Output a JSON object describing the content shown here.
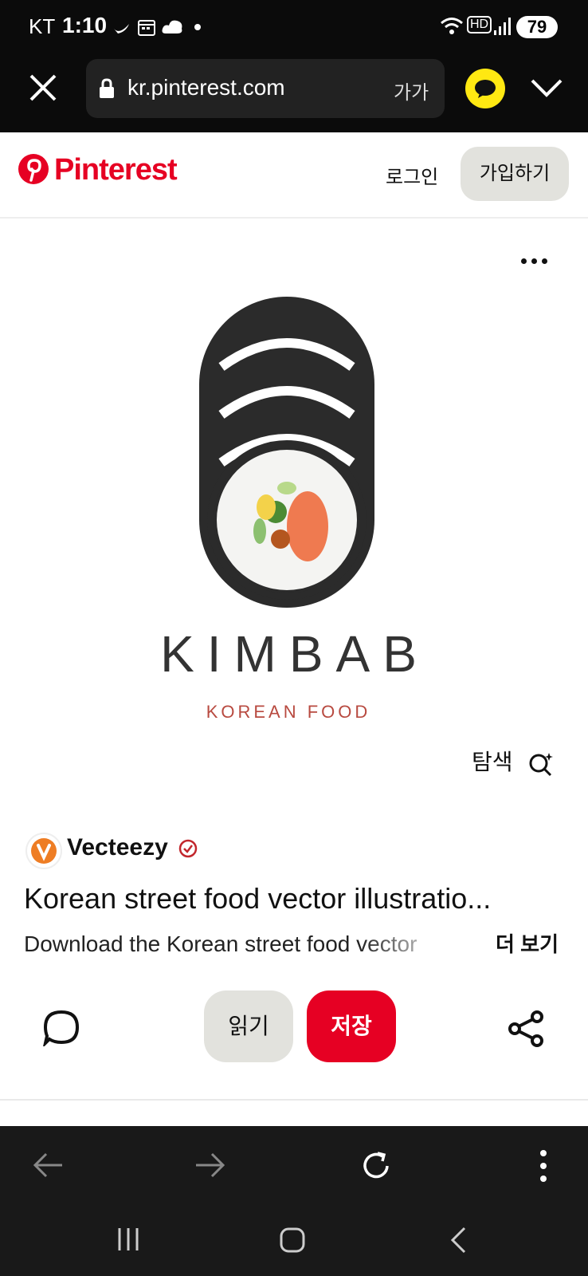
{
  "status_bar": {
    "carrier": "KT",
    "time": "1:10",
    "battery": "79",
    "network_label": "HD"
  },
  "browser": {
    "url": "kr.pinterest.com",
    "text_size_label": "가가"
  },
  "header": {
    "logo": "Pinterest",
    "login_label": "로그인",
    "signup_label": "가입하기"
  },
  "pin": {
    "image_brand_title": "KIMBAB",
    "image_brand_subtitle": "KOREAN FOOD",
    "explore_label": "탐색",
    "source_name": "Vecteezy",
    "title": "Korean street food vector illustratio...",
    "description": "Download the Korean street food vector",
    "see_more_label": "더 보기",
    "read_label": "읽기",
    "save_label": "저장"
  },
  "colors": {
    "pinterest_red": "#e60023",
    "secondary_button": "#e2e2dd",
    "kakao_yellow": "#ffe812",
    "dark_bar": "#0b0b0b"
  }
}
